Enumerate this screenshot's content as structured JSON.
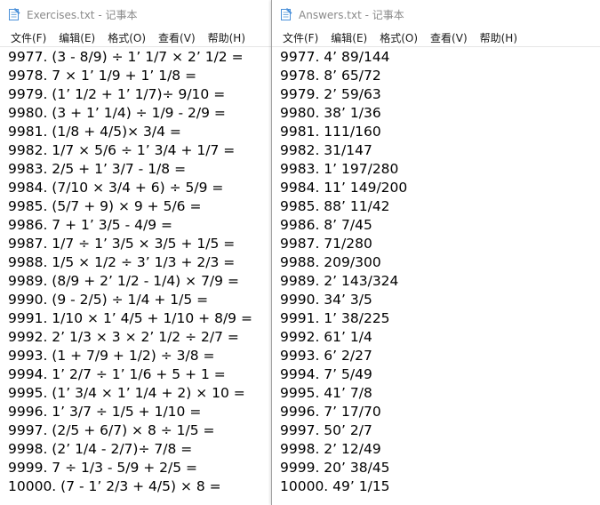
{
  "exercises_window": {
    "title": "Exercises.txt - 记事本",
    "menu": [
      "文件(F)",
      "编辑(E)",
      "格式(O)",
      "查看(V)",
      "帮助(H)"
    ],
    "lines": [
      "9977. (3 - 8/9) ÷ 1’ 1/7 × 2’ 1/2 =",
      "9978. 7 × 1’ 1/9 + 1’ 1/8 =",
      "9979. (1’ 1/2 + 1’ 1/7)÷ 9/10 =",
      "9980. (3 + 1’ 1/4) ÷ 1/9 - 2/9 =",
      "9981. (1/8 + 4/5)× 3/4 =",
      "9982. 1/7 × 5/6 ÷ 1’ 3/4 + 1/7 =",
      "9983. 2/5 + 1’ 3/7 - 1/8 =",
      "9984. (7/10 × 3/4 + 6) ÷ 5/9 =",
      "9985. (5/7 + 9) × 9 + 5/6 =",
      "9986. 7 + 1’ 3/5 - 4/9 =",
      "9987. 1/7 ÷ 1’ 3/5 × 3/5 + 1/5 =",
      "9988. 1/5 × 1/2 ÷ 3’ 1/3 + 2/3 =",
      "9989. (8/9 + 2’ 1/2 - 1/4) × 7/9 =",
      "9990. (9 - 2/5) ÷ 1/4 + 1/5 =",
      "9991. 1/10 × 1’ 4/5 + 1/10 + 8/9 =",
      "9992. 2’ 1/3 × 3 × 2’ 1/2 ÷ 2/7 =",
      "9993. (1 + 7/9 + 1/2) ÷ 3/8 =",
      "9994. 1’ 2/7 ÷ 1’ 1/6 + 5 + 1 =",
      "9995. (1’ 3/4 × 1’ 1/4 + 2) × 10 =",
      "9996. 1’ 3/7 ÷ 1/5 + 1/10 =",
      "9997. (2/5 + 6/7) × 8 ÷ 1/5 =",
      "9998. (2’ 1/4 - 2/7)÷ 7/8 =",
      "9999. 7 ÷ 1/3 - 5/9 + 2/5 =",
      "10000. (7 - 1’ 2/3 + 4/5) × 8 ="
    ]
  },
  "answers_window": {
    "title": "Answers.txt - 记事本",
    "menu": [
      "文件(F)",
      "编辑(E)",
      "格式(O)",
      "查看(V)",
      "帮助(H)"
    ],
    "lines": [
      "9977. 4’ 89/144",
      "9978. 8’ 65/72",
      "9979. 2’ 59/63",
      "9980. 38’ 1/36",
      "9981. 111/160",
      "9982. 31/147",
      "9983. 1’ 197/280",
      "9984. 11’ 149/200",
      "9985. 88’ 11/42",
      "9986. 8’ 7/45",
      "9987. 71/280",
      "9988. 209/300",
      "9989. 2’ 143/324",
      "9990. 34’ 3/5",
      "9991. 1’ 38/225",
      "9992. 61’ 1/4",
      "9993. 6’ 2/27",
      "9994. 7’ 5/49",
      "9995. 41’ 7/8",
      "9996. 7’ 17/70",
      "9997. 50’ 2/7",
      "9998. 2’ 12/49",
      "9999. 20’ 38/45",
      "10000. 49’ 1/15"
    ]
  },
  "icons": {
    "window_icon": "notepad-icon"
  },
  "colors": {
    "title_text": "#8a8a8a",
    "icon_blue": "#4a90d9"
  }
}
